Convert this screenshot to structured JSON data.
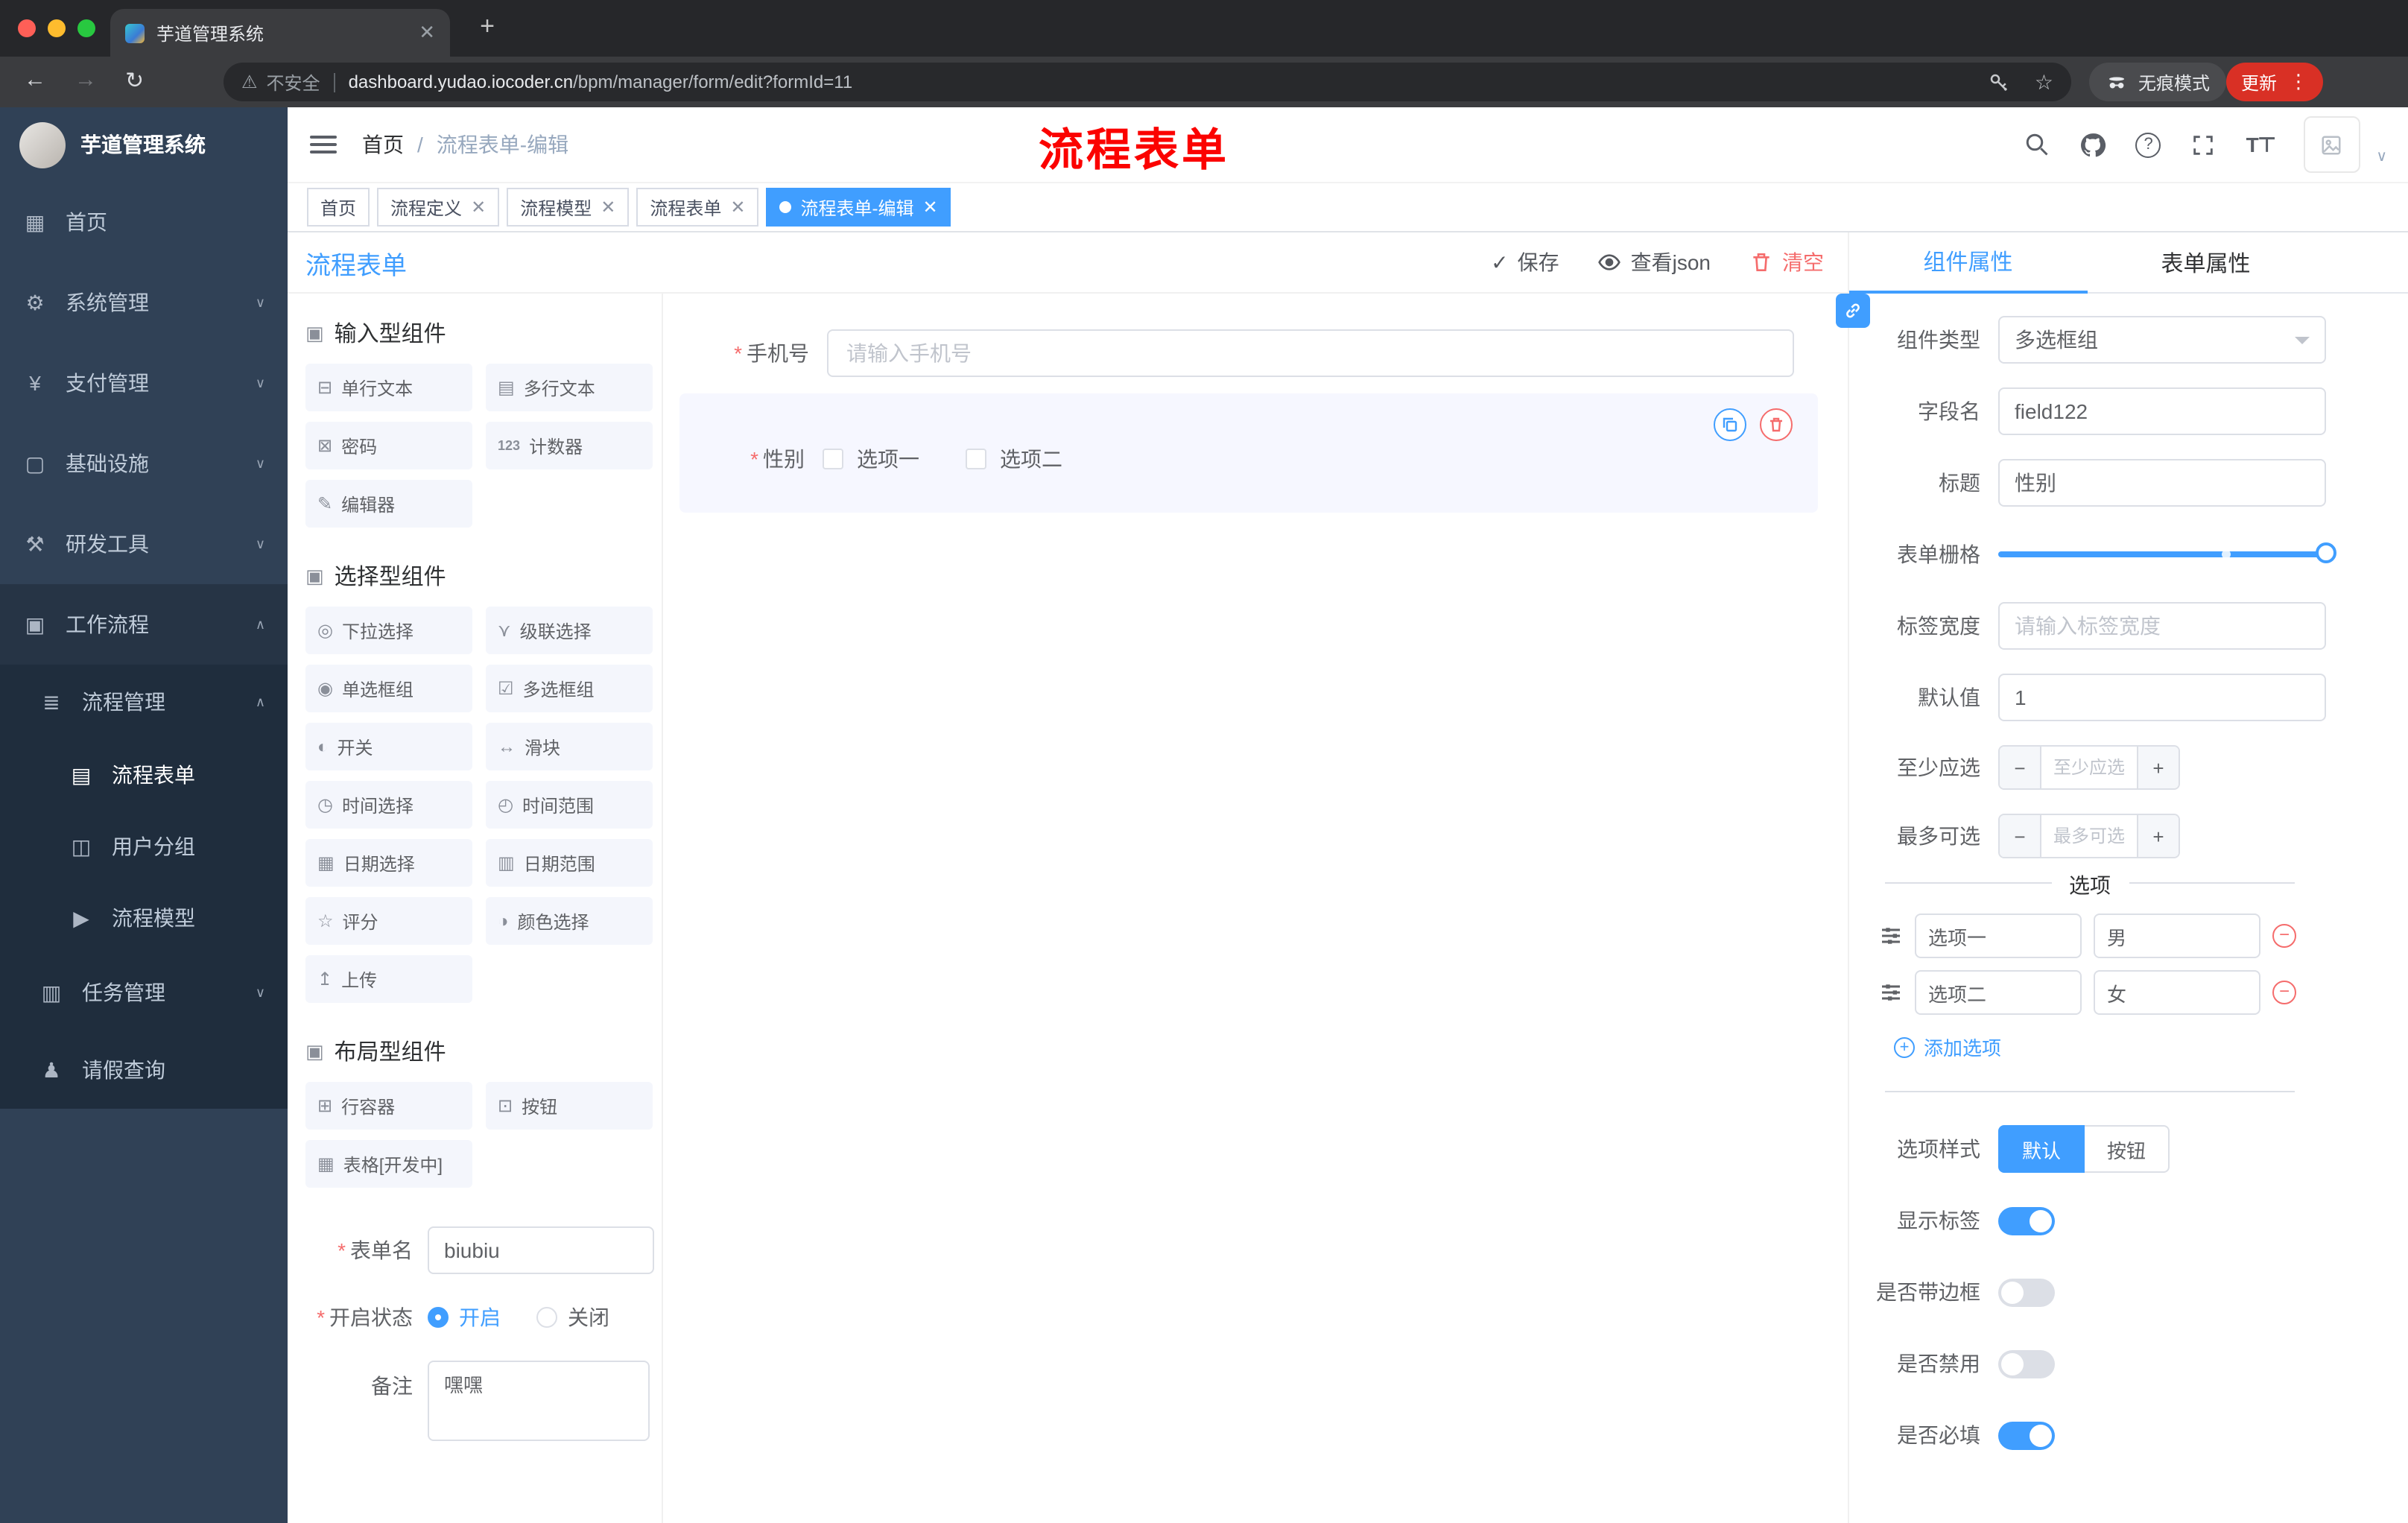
{
  "colors": {
    "accent": "#409EFF",
    "danger": "#F56C6C",
    "sidebar_bg": "#304156",
    "submenu_bg": "#1F2D3D",
    "annotation_red": "#FB0200",
    "update_pill": "#D93025"
  },
  "browser": {
    "tab_title": "芋道管理系统",
    "security_label": "不安全",
    "url_domain": "dashboard.yudao.iocoder.cn",
    "url_path": "/bpm/manager/form/edit?formId=11",
    "incognito_label": "无痕模式",
    "update_label": "更新"
  },
  "annotation": {
    "text": "流程表单"
  },
  "sidebar": {
    "logo_title": "芋道管理系统",
    "menu": [
      {
        "label": "首页"
      },
      {
        "label": "系统管理"
      },
      {
        "label": "支付管理"
      },
      {
        "label": "基础设施"
      },
      {
        "label": "研发工具"
      },
      {
        "label": "工作流程"
      },
      {
        "label": "流程管理"
      },
      {
        "label": "流程表单"
      },
      {
        "label": "用户分组"
      },
      {
        "label": "流程模型"
      },
      {
        "label": "任务管理"
      },
      {
        "label": "请假查询"
      }
    ]
  },
  "breadcrumb": {
    "home": "首页",
    "separator": "/",
    "current": "流程表单-编辑"
  },
  "tags": [
    {
      "label": "首页"
    },
    {
      "label": "流程定义"
    },
    {
      "label": "流程模型"
    },
    {
      "label": "流程表单"
    },
    {
      "label": "流程表单-编辑"
    }
  ],
  "designer": {
    "title": "流程表单",
    "save_label": "保存",
    "view_json_label": "查看json",
    "clear_label": "清空",
    "groups": [
      {
        "title": "输入型组件",
        "items": [
          "单行文本",
          "多行文本",
          "密码",
          "计数器",
          "编辑器"
        ]
      },
      {
        "title": "选择型组件",
        "items": [
          "下拉选择",
          "级联选择",
          "单选框组",
          "多选框组",
          "开关",
          "滑块",
          "时间选择",
          "时间范围",
          "日期选择",
          "日期范围",
          "评分",
          "颜色选择",
          "上传"
        ]
      },
      {
        "title": "布局型组件",
        "items": [
          "行容器",
          "按钮",
          "表格[开发中]"
        ]
      }
    ],
    "meta": {
      "name_label": "表单名",
      "name_value": "biubiu",
      "status_label": "开启状态",
      "status_on": "开启",
      "status_off": "关闭",
      "remark_label": "备注",
      "remark_value": "嘿嘿"
    },
    "canvas": {
      "phone_label": "手机号",
      "phone_placeholder": "请输入手机号",
      "gender_label": "性别",
      "gender_option1": "选项一",
      "gender_option2": "选项二"
    }
  },
  "properties": {
    "tab_component": "组件属性",
    "tab_form": "表单属性",
    "type_label": "组件类型",
    "type_value": "多选框组",
    "field_label": "字段名",
    "field_value": "field122",
    "title_label": "标题",
    "title_value": "性别",
    "grid_label": "表单栅格",
    "label_width_label": "标签宽度",
    "label_width_placeholder": "请输入标签宽度",
    "default_label": "默认值",
    "default_value": "1",
    "min_label": "至少应选",
    "min_placeholder": "至少应选",
    "max_label": "最多可选",
    "max_placeholder": "最多可选",
    "options_title": "选项",
    "options": [
      {
        "label": "选项一",
        "value": "男"
      },
      {
        "label": "选项二",
        "value": "女"
      }
    ],
    "add_option_label": "添加选项",
    "style_label": "选项样式",
    "style_default": "默认",
    "style_button": "按钮",
    "show_label_label": "显示标签",
    "border_label": "是否带边框",
    "disabled_label": "是否禁用",
    "required_label": "是否必填"
  }
}
